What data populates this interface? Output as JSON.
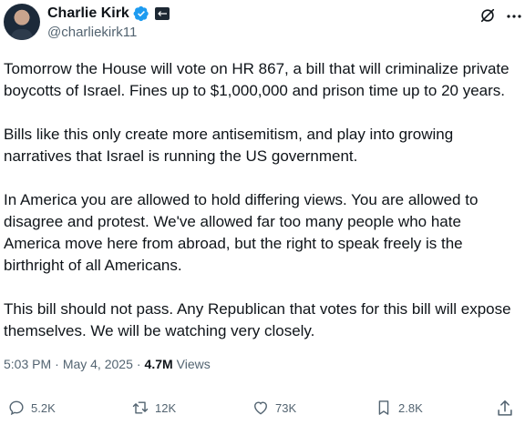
{
  "author": {
    "display_name": "Charlie Kirk",
    "handle": "@charliekirk11",
    "verified": true
  },
  "paragraphs": [
    "Tomorrow the House will vote on HR 867, a bill that will criminalize private boycotts of Israel. Fines up to $1,000,000 and prison time up to 20 years.",
    "Bills like this only create more antisemitism, and play into growing narratives that Israel is running the US government.",
    "In America you are allowed to hold differing views. You are allowed to disagree and protest. We've allowed far too many people who hate America move here from abroad, but the right to speak freely is the birthright of all Americans.",
    "This bill should not pass. Any Republican that votes for this bill will expose themselves. We will be watching very closely."
  ],
  "meta": {
    "time": "5:03 PM",
    "separator": "·",
    "date": "May 4, 2025",
    "views_count": "4.7M",
    "views_label": "Views"
  },
  "actions": {
    "replies": "5.2K",
    "reposts": "12K",
    "likes": "73K",
    "bookmarks": "2.8K"
  },
  "icons": {
    "verified": "verified-badge-icon",
    "affiliate": "affiliate-badge-icon",
    "grok": "grok-icon",
    "reply": "reply-icon",
    "repost": "repost-icon",
    "like": "heart-icon",
    "bookmark": "bookmark-icon",
    "share": "share-icon"
  },
  "colors": {
    "text": "#0f1419",
    "secondary": "#536471",
    "verified": "#1d9bf0"
  }
}
